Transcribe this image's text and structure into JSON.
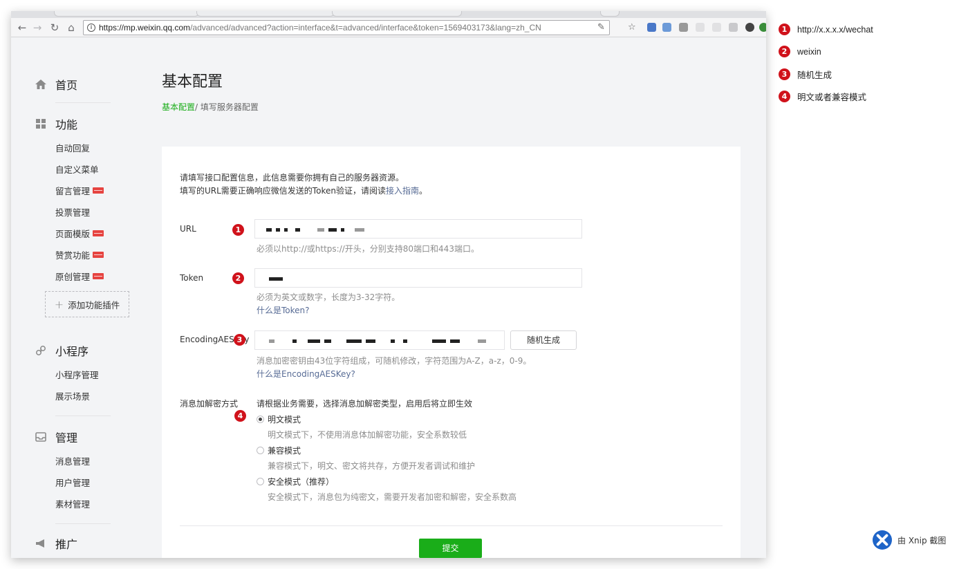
{
  "browser": {
    "url_host": "https://mp.weixin.qq.com",
    "url_path": "/advanced/advanced?action=interface&t=advanced/interface&token=1569403173&lang=zh_CN"
  },
  "sidebar": {
    "home": "首页",
    "features": {
      "label": "功能",
      "items": [
        "自动回复",
        "自定义菜单",
        "留言管理",
        "投票管理",
        "页面模版",
        "赞赏功能",
        "原创管理"
      ],
      "add_plugin": "添加功能插件"
    },
    "miniprogram": {
      "label": "小程序",
      "items": [
        "小程序管理",
        "展示场景"
      ]
    },
    "manage": {
      "label": "管理",
      "items": [
        "消息管理",
        "用户管理",
        "素材管理"
      ]
    },
    "promote": {
      "label": "推广"
    }
  },
  "main": {
    "title": "基本配置",
    "breadcrumb": {
      "link": "基本配置",
      "current": "/ 填写服务器配置"
    },
    "intro_line1": "请填写接口配置信息，此信息需要你拥有自己的服务器资源。",
    "intro_line2_prefix": "填写的URL需要正确响应微信发送的Token验证，请阅读",
    "intro_line2_link": "接入指南",
    "intro_line2_suffix": "。",
    "url": {
      "label": "URL",
      "hint": "必须以http://或https://开头，分别支持80端口和443端口。"
    },
    "token": {
      "label": "Token",
      "hint": "必须为英文或数字，长度为3-32字符。",
      "help_link": "什么是Token?"
    },
    "aeskey": {
      "label": "EncodingAESKey",
      "generate_button": "随机生成",
      "hint": "消息加密密钥由43位字符组成，可随机修改，字符范围为A-Z，a-z，0-9。",
      "help_link": "什么是EncodingAESKey?"
    },
    "encryption": {
      "label": "消息加解密方式",
      "hint": "请根据业务需要，选择消息加解密类型，启用后将立即生效",
      "options": [
        {
          "label": "明文模式",
          "desc": "明文模式下，不使用消息体加解密功能，安全系数较低",
          "checked": true
        },
        {
          "label": "兼容模式",
          "desc": "兼容模式下，明文、密文将共存，方便开发者调试和维护",
          "checked": false
        },
        {
          "label": "安全模式（推荐）",
          "desc": "安全模式下，消息包为纯密文，需要开发者加密和解密，安全系数高",
          "checked": false
        }
      ]
    },
    "submit": "提交"
  },
  "annotations": {
    "markers": [
      "1",
      "2",
      "3",
      "4"
    ],
    "legend": [
      "http://x.x.x.x/wechat",
      "weixin",
      "随机生成",
      "明文或者兼容模式"
    ],
    "marker_color": "#d0121b"
  },
  "watermark": "由 Xnip 截图",
  "colors": {
    "accent_green": "#1aad19",
    "link_blue": "#576b95"
  }
}
